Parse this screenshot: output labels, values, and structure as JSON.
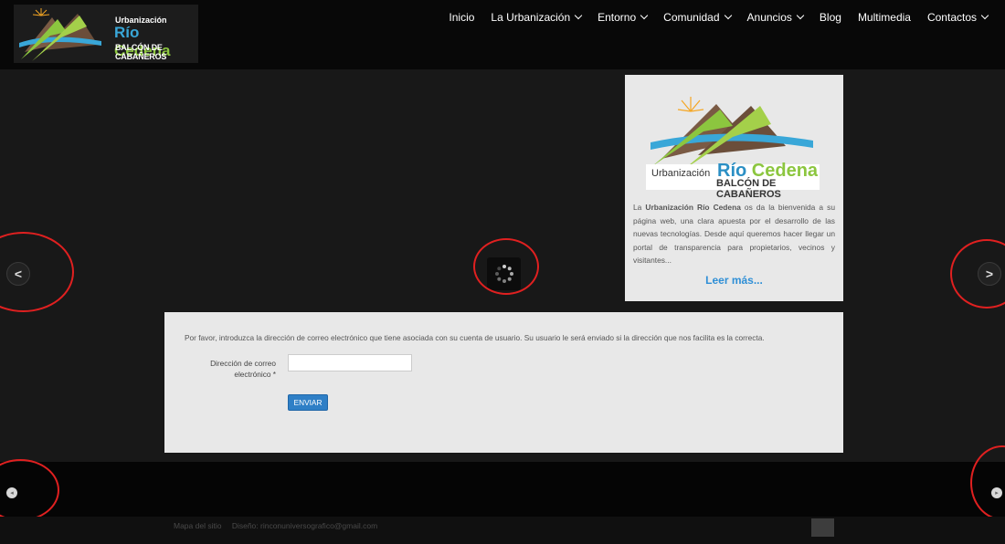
{
  "header": {
    "logo": {
      "line1": "Urbanización",
      "rio": "Río",
      "cedena": "Cedena",
      "line3": "BALCÓN DE CABAÑEROS"
    },
    "nav": [
      {
        "label": "Inicio",
        "dropdown": false
      },
      {
        "label": "La Urbanización",
        "dropdown": true
      },
      {
        "label": "Entorno",
        "dropdown": true
      },
      {
        "label": "Comunidad",
        "dropdown": true
      },
      {
        "label": "Anuncios",
        "dropdown": true
      },
      {
        "label": "Blog",
        "dropdown": false
      },
      {
        "label": "Multimedia",
        "dropdown": false
      },
      {
        "label": "Contactos",
        "dropdown": true
      }
    ]
  },
  "slider": {
    "prev_icon": "chevron-left-icon",
    "next_icon": "chevron-right-icon",
    "prev_glyph": "<",
    "next_glyph": ">",
    "loading_icon": "spinner-icon"
  },
  "welcome": {
    "urb": "Urbanización",
    "rio": "Río",
    "cedena": "Cedena",
    "balcon": "BALCÓN DE CABAÑEROS",
    "text_bold": "Urbanización Río Cedena",
    "text_pre": "La ",
    "text_rest": " os da la bienvenida a su página web, una clara apuesta por el desarrollo de las nuevas tecnologías. Desde aquí queremos hacer llegar un portal de transparencia para propietarios, vecinos y visitantes...",
    "read_more": "Leer más..."
  },
  "form": {
    "intro": "Por favor, introduzca la dirección de correo electrónico que tiene asociada con su cuenta de usuario. Su usuario le será enviado si la dirección que nos facilita es la correcta.",
    "email_label": "Dirección de correo electrónico *",
    "email_value": "",
    "submit": "ENVIAR"
  },
  "bottom": {
    "prev_icon": "small-left-arrow-icon",
    "next_icon": "small-right-arrow-icon",
    "prev_glyph": "◂",
    "next_glyph": "▸"
  },
  "footer": {
    "sitemap": "Mapa del sitio",
    "design": "Diseño: rinconuniversografico@gmail.com"
  },
  "colors": {
    "highlight_ring": "#e02020",
    "link": "#2f8fd6",
    "button": "#2f7fc6"
  }
}
